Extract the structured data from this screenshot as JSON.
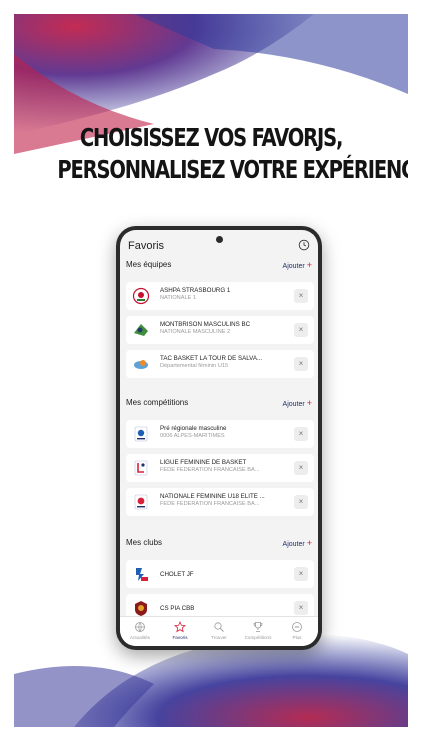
{
  "headline": {
    "line1": "CHOISISSEZ VOS FAVORJS,",
    "line2": "PERSONNALISEZ VOTRE EXPÉRIENCE"
  },
  "app": {
    "title": "Favoris",
    "add_label": "Ajouter",
    "add_symbol": "+",
    "remove_symbol": "×"
  },
  "sections": {
    "teams": {
      "title": "Mes équipes",
      "items": [
        {
          "name": "ASHPA STRASBOURG 1",
          "sub": "NATIONALE 1"
        },
        {
          "name": "MONTBRISON MASCULINS BC",
          "sub": "NATIONALE MASCULINE 2"
        },
        {
          "name": "TAC BASKET LA TOUR DE SALVA...",
          "sub": "Départemental féminin U15"
        }
      ]
    },
    "competitions": {
      "title": "Mes compétitions",
      "items": [
        {
          "name": "Pré régionale masculine",
          "sub": "0006 ALPES-MARITIMES"
        },
        {
          "name": "LIGUE FEMININE DE BASKET",
          "sub": "FEDE FEDERATION FRANCAISE BA..."
        },
        {
          "name": "NATIONALE FEMININE U18 ELITE ...",
          "sub": "FEDE FEDERATION FRANCAISE BA..."
        }
      ]
    },
    "clubs": {
      "title": "Mes clubs",
      "items": [
        {
          "name": "CHOLET JF"
        },
        {
          "name": "CS PIA CBB"
        }
      ]
    }
  },
  "tabs": [
    {
      "label": "Actualités",
      "icon": "globe-icon"
    },
    {
      "label": "Favoris",
      "icon": "star-icon",
      "active": true
    },
    {
      "label": "Trouver",
      "icon": "search-icon"
    },
    {
      "label": "Compétitions",
      "icon": "trophy-icon"
    },
    {
      "label": "Plus",
      "icon": "more-icon"
    }
  ],
  "colors": {
    "accent_navy": "#1e2f6b",
    "accent_red": "#d8203b",
    "background_blue": "#2f3d9c",
    "background_magenta": "#b0204a"
  }
}
